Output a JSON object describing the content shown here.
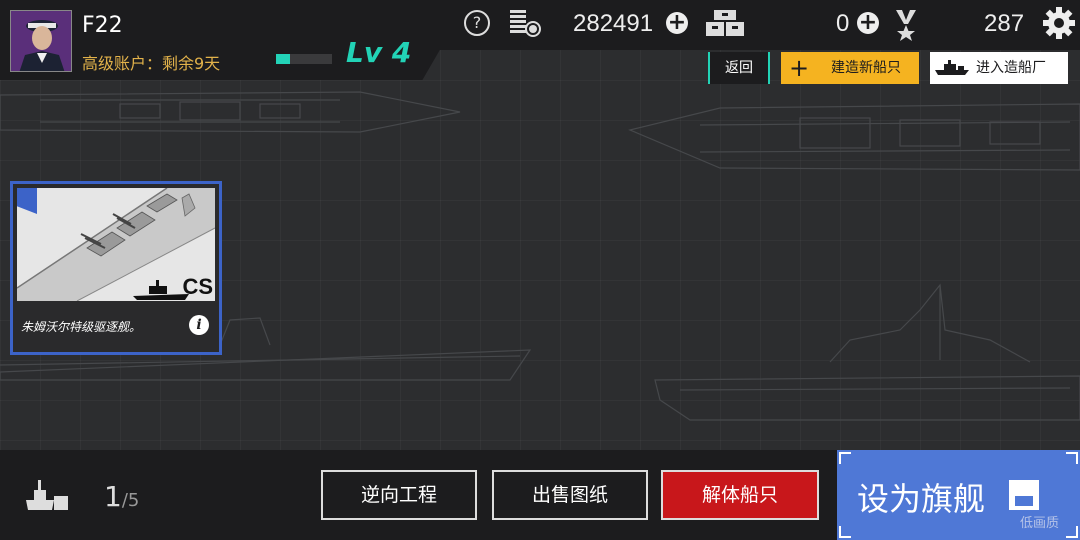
{
  "player": {
    "name": "F22",
    "account_status": "高级账户：剩余9天",
    "level": "Lv 4",
    "xp_progress": 0.25
  },
  "resources": {
    "help": "?",
    "credits": "282491",
    "supplies": "0",
    "medals": "287"
  },
  "actions": {
    "back": "返回",
    "build_new_ship": "建造新船只",
    "enter_shipyard": "进入造船厂"
  },
  "ship_card": {
    "class": "CS",
    "name": "朱姆沃尔特级驱逐舰。",
    "info": "i"
  },
  "dock": {
    "count": "1",
    "capacity": "/5"
  },
  "bottom_buttons": {
    "reverse_engineering": "逆向工程",
    "sell_blueprint": "出售图纸",
    "dismantle_ship": "解体船只",
    "set_flagship": "设为旗舰"
  },
  "graphics_quality": "低画质",
  "colors": {
    "accent_teal": "#22d3b6",
    "gold": "#e2b24a",
    "build_yellow": "#f5b320",
    "dismantle_red": "#c8171b",
    "flagship_blue": "#4f78d6",
    "card_border": "#3c63c8"
  }
}
